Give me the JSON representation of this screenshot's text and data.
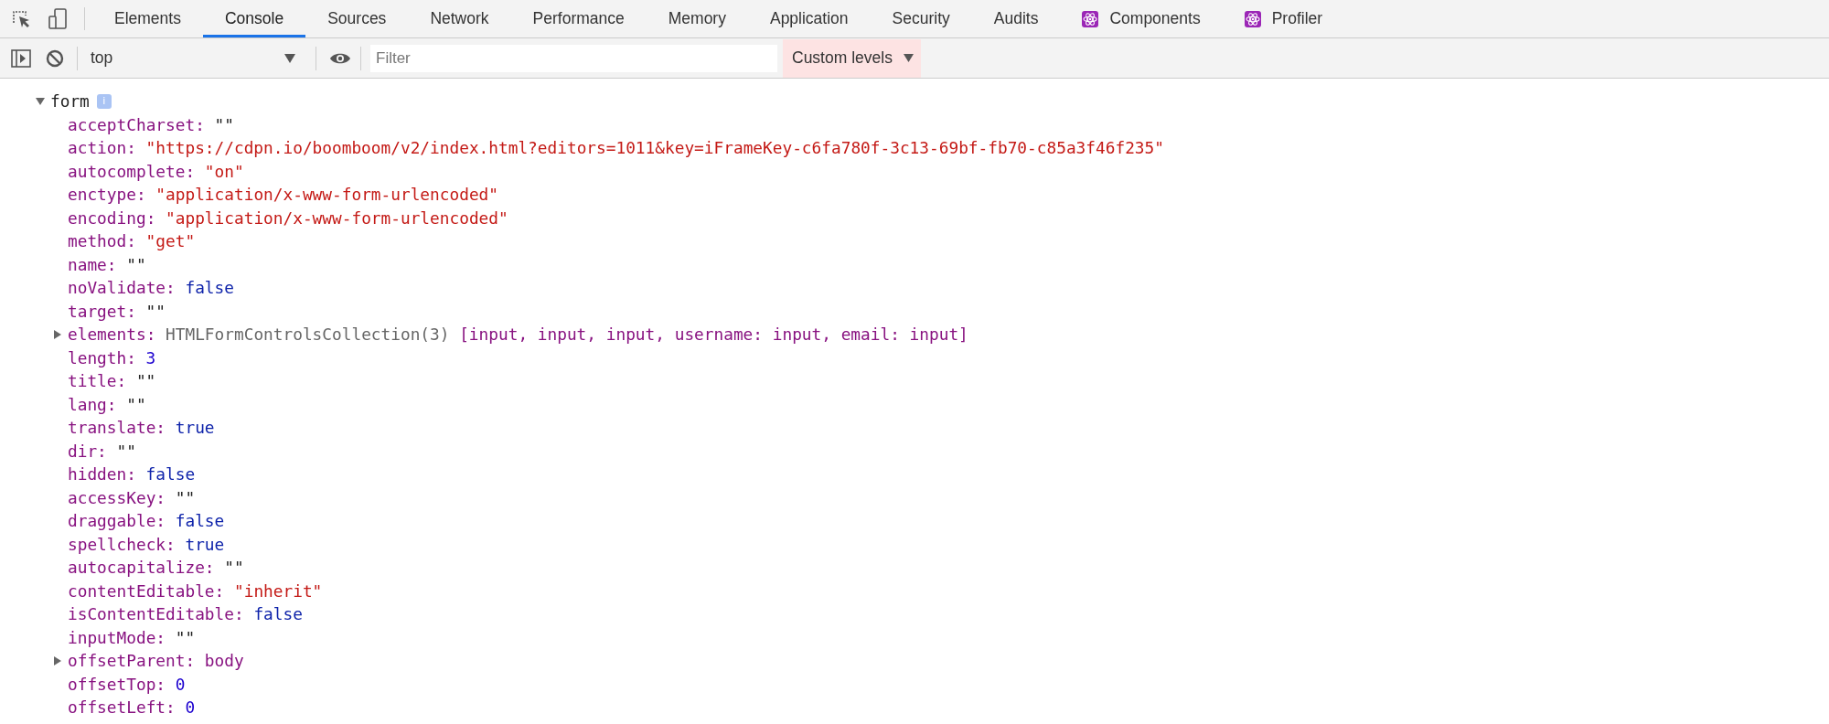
{
  "tabs": [
    {
      "label": "Elements",
      "selected": false
    },
    {
      "label": "Console",
      "selected": true
    },
    {
      "label": "Sources",
      "selected": false
    },
    {
      "label": "Network",
      "selected": false
    },
    {
      "label": "Performance",
      "selected": false
    },
    {
      "label": "Memory",
      "selected": false
    },
    {
      "label": "Application",
      "selected": false
    },
    {
      "label": "Security",
      "selected": false
    },
    {
      "label": "Audits",
      "selected": false
    },
    {
      "label": "Components",
      "selected": false,
      "kind": "react"
    },
    {
      "label": "Profiler",
      "selected": false,
      "kind": "react"
    }
  ],
  "toolbar": {
    "context": "top",
    "filter": {
      "placeholder": "Filter"
    },
    "levels": "Custom levels"
  },
  "console": {
    "root": {
      "name": "form",
      "badge": "i",
      "expanded": true,
      "children": [
        {
          "name": "acceptCharset:",
          "value": "\"\"",
          "kind": "empty"
        },
        {
          "name": "action:",
          "value": "\"https://cdpn.io/boomboom/v2/index.html?editors=1011&key=iFrameKey-c6fa780f-3c13-69bf-fb70-c85a3f46f235\"",
          "kind": "string"
        },
        {
          "name": "autocomplete:",
          "value": "\"on\"",
          "kind": "string"
        },
        {
          "name": "enctype:",
          "value": "\"application/x-www-form-urlencoded\"",
          "kind": "string"
        },
        {
          "name": "encoding:",
          "value": "\"application/x-www-form-urlencoded\"",
          "kind": "string"
        },
        {
          "name": "method:",
          "value": "\"get\"",
          "kind": "string"
        },
        {
          "name": "name:",
          "value": "\"\"",
          "kind": "empty"
        },
        {
          "name": "noValidate:",
          "value": "false",
          "kind": "keyword"
        },
        {
          "name": "target:",
          "value": "\"\"",
          "kind": "empty"
        },
        {
          "name": "elements:",
          "value": "HTMLFormControlsCollection(3)",
          "kind": "class",
          "preview": "[input, input, input, username: input, email: input]",
          "expanded": false
        },
        {
          "name": "length:",
          "value": "3",
          "kind": "number"
        },
        {
          "name": "title:",
          "value": "\"\"",
          "kind": "empty"
        },
        {
          "name": "lang:",
          "value": "\"\"",
          "kind": "empty"
        },
        {
          "name": "translate:",
          "value": "true",
          "kind": "keyword"
        },
        {
          "name": "dir:",
          "value": "\"\"",
          "kind": "empty"
        },
        {
          "name": "hidden:",
          "value": "false",
          "kind": "keyword"
        },
        {
          "name": "accessKey:",
          "value": "\"\"",
          "kind": "empty"
        },
        {
          "name": "draggable:",
          "value": "false",
          "kind": "keyword"
        },
        {
          "name": "spellcheck:",
          "value": "true",
          "kind": "keyword"
        },
        {
          "name": "autocapitalize:",
          "value": "\"\"",
          "kind": "empty"
        },
        {
          "name": "contentEditable:",
          "value": "\"inherit\"",
          "kind": "string"
        },
        {
          "name": "isContentEditable:",
          "value": "false",
          "kind": "keyword"
        },
        {
          "name": "inputMode:",
          "value": "\"\"",
          "kind": "empty"
        },
        {
          "name": "offsetParent:",
          "value": "body",
          "kind": "node",
          "expanded": false
        },
        {
          "name": "offsetTop:",
          "value": "0",
          "kind": "number"
        },
        {
          "name": "offsetLeft:",
          "value": "0",
          "kind": "number"
        }
      ]
    }
  }
}
